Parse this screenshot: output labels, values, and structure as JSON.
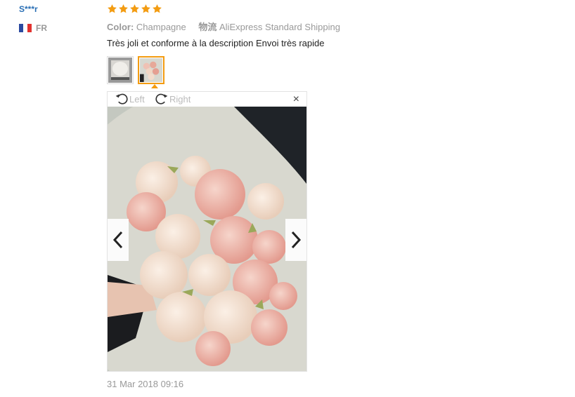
{
  "review": {
    "user_name": "S***r",
    "country_code": "FR",
    "rating": 5,
    "color_label": "Color:",
    "color_value": "Champagne",
    "shipping_label": "物流",
    "shipping_value": "AliExpress Standard Shipping",
    "feedback": "Très joli et conforme à la description Envoi très rapide",
    "date": "31 Mar 2018 09:16"
  },
  "viewer": {
    "rotate_left_label": "Left",
    "rotate_right_label": "Right",
    "close_label": "×"
  },
  "colors": {
    "star": "#f39c12",
    "thumb_active_border": "#f39c12",
    "username": "#2a6fb5"
  },
  "icons": [
    "rotate-left-icon",
    "rotate-right-icon",
    "close-icon",
    "chevron-left-icon",
    "chevron-right-icon",
    "star-icon",
    "france-flag-icon"
  ]
}
